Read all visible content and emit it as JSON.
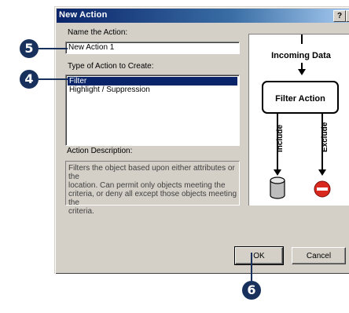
{
  "dialog": {
    "title": "New Action",
    "help_button": "?",
    "name_label": "Name  the Action:",
    "name_value": "New Action 1",
    "type_label": "Type of Action to Create:",
    "action_types": [
      "Filter",
      "Highlight / Suppression"
    ],
    "selected_index": 0,
    "description_label": "Action Description:",
    "description_lines": [
      "Filters the object based upon either attributes or the",
      "location.  Can permit only objects meeting the",
      "criteria, or deny all except those objects meeting the",
      "criteria."
    ],
    "ok_label": "OK",
    "cancel_label": "Cancel"
  },
  "diagram": {
    "incoming_label": "Incoming  Data",
    "box_label": "Filter Action",
    "include_label": "Include",
    "exclude_label": "Exclude"
  },
  "callouts": [
    "5",
    "4",
    "6"
  ],
  "colors": {
    "titlebar": "#0a246a",
    "selection": "#0a246a",
    "callout": "#17305c",
    "exclude_red": "#d9281e"
  }
}
